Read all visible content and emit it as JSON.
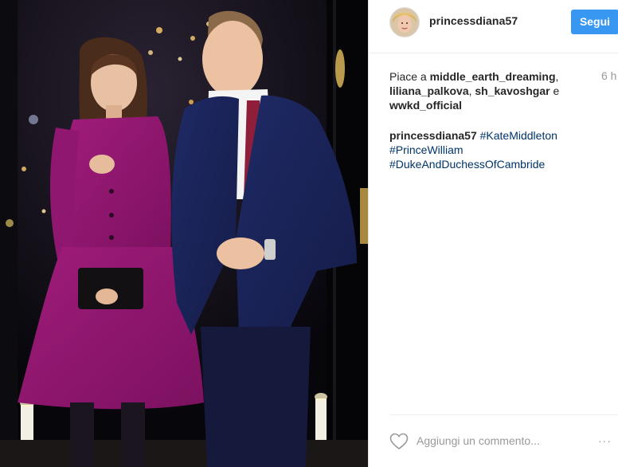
{
  "post": {
    "username": "princessdiana57",
    "follow_label": "Segui",
    "likes_prefix": "Piace a ",
    "liked_by": [
      "middle_earth_dreaming",
      "liliana_palkova",
      "sh_kavoshgar",
      "wwkd_official"
    ],
    "likes_sep1": ", ",
    "likes_and": " e ",
    "timestamp": "6 h",
    "caption_user": "princessdiana57",
    "hashtags": [
      "#KateMiddleton",
      "#PrinceWilliam",
      "#DukeAndDuchessOfCambride"
    ],
    "comment_placeholder": "Aggiungi un commento...",
    "more_label": "···"
  },
  "icons": {
    "heart": "heart-icon",
    "avatar": "avatar-image",
    "photo": "post-photo",
    "more": "more-options-icon"
  },
  "colors": {
    "follow_button": "#3897f0",
    "hashtag": "#003569",
    "muted": "#999999",
    "text": "#262626"
  }
}
